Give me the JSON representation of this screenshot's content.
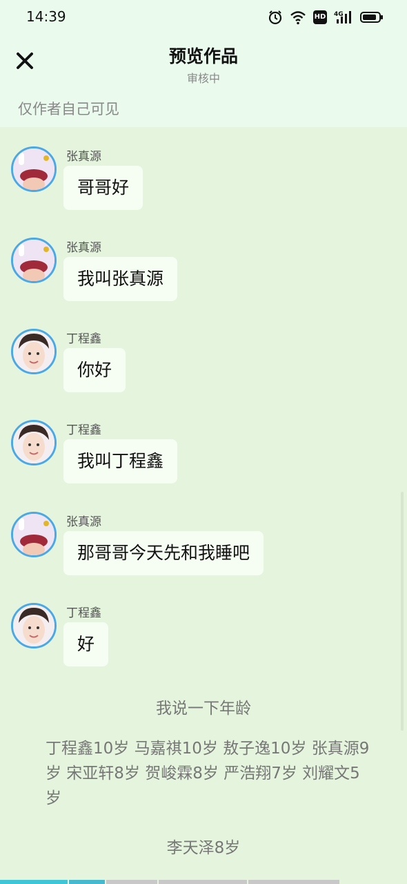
{
  "status_bar": {
    "time": "14:39",
    "icons": [
      "alarm-icon",
      "wifi-icon",
      "hd-icon",
      "signal-4g-icon",
      "battery-icon"
    ],
    "hd_label": "HD",
    "network_label": "4G"
  },
  "header": {
    "title": "预览作品",
    "subtitle": "审核中",
    "close_icon": "close-icon"
  },
  "visibility_note": "仅作者自己可见",
  "messages": [
    {
      "sender": "张真源",
      "text": "哥哥好",
      "avatar": "avatar-zhang"
    },
    {
      "sender": "张真源",
      "text": "我叫张真源",
      "avatar": "avatar-zhang"
    },
    {
      "sender": "丁程鑫",
      "text": "你好",
      "avatar": "avatar-ding"
    },
    {
      "sender": "丁程鑫",
      "text": "我叫丁程鑫",
      "avatar": "avatar-ding"
    },
    {
      "sender": "张真源",
      "text": "那哥哥今天先和我睡吧",
      "avatar": "avatar-zhang"
    },
    {
      "sender": "丁程鑫",
      "text": "好",
      "avatar": "avatar-ding"
    }
  ],
  "narration": {
    "heading": "我说一下年龄",
    "ages": "丁程鑫10岁  马嘉祺10岁 敖子逸10岁 张真源9岁 宋亚轩8岁 贺峻霖8岁 严浩翔7岁  刘耀文5岁",
    "last": "李天泽8岁"
  },
  "colors": {
    "background": "#e4f4dd",
    "header_bg": "#eafbee",
    "bubble": "#f6fdf3",
    "avatar_ring": "#4aa8e6",
    "progress_active": "#3ec6d6",
    "progress_inactive": "#bdbdbd"
  }
}
